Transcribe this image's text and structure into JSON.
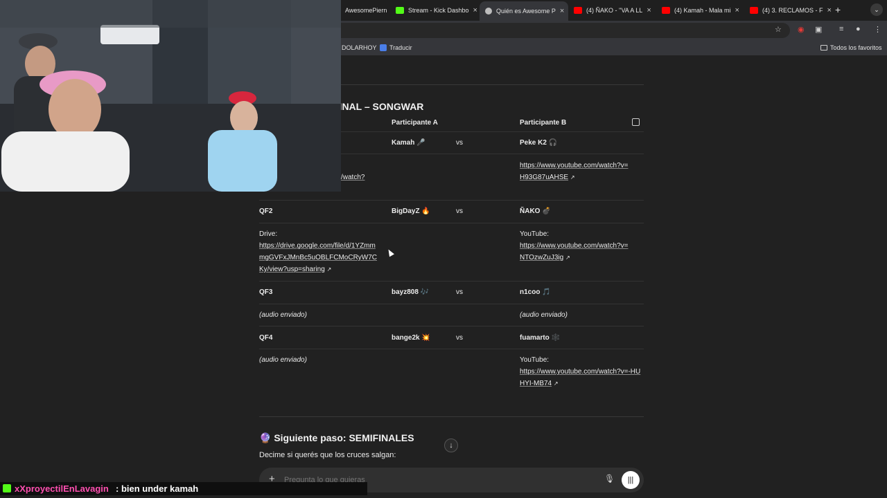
{
  "browser": {
    "tabs": [
      {
        "label": "AwesomePiern",
        "color": "#8a8a8a"
      },
      {
        "label": "Stream - Kick Dashbo",
        "color": "#53fc18"
      },
      {
        "label": "Quién es Awesome P",
        "color": "#bdbdbd",
        "active": true
      },
      {
        "label": "(4) ÑAKO - ''VA A LL",
        "color": "#ff0000"
      },
      {
        "label": "(4) Kamah - Mala mi",
        "color": "#ff0000"
      },
      {
        "label": "(4) 3. RECLAMOS - F",
        "color": "#ff0000"
      }
    ],
    "close_glyph": "×",
    "new_tab_glyph": "+",
    "bookmarks": {
      "items": [
        "DOLARHOY",
        "Traducir"
      ],
      "all_label": "Todos los favoritos"
    }
  },
  "doc": {
    "heading": "FINAL – SONGWAR",
    "columns": {
      "a": "Participante A",
      "b": "Participante B"
    },
    "vs": "vs",
    "rows": {
      "qf1": {
        "a": "Kamah 🎤",
        "b": "Peke K2 🎧",
        "a_link": "/watch?",
        "b_link": "https://www.youtube.com/watch?v=H93G87uAHSE"
      },
      "qf2": {
        "id": "QF2",
        "a": "BigDayZ 🔥",
        "b": "ÑAKO 💣",
        "a_prefix": "Drive:",
        "a_link": "https://drive.google.com/file/d/1YZmmmgGVFxJMnBc5uOBLFCMoCRyW7CKy/view?usp=sharing",
        "b_prefix": "YouTube:",
        "b_link": "https://www.youtube.com/watch?v=NTOzwZuJ3ig"
      },
      "qf3": {
        "id": "QF3",
        "a": "bayz808 🎶",
        "b": "n1coo 🎵",
        "a_note": "(audio enviado)",
        "b_note": "(audio enviado)"
      },
      "qf4": {
        "id": "QF4",
        "a": "bange2k 💥",
        "b": "fuamarto 🕸️",
        "a_note": "(audio enviado)",
        "b_prefix": "YouTube:",
        "b_link": "https://www.youtube.com/watch?v=-HUHYI-MB74"
      }
    },
    "next": {
      "title": "🔮 Siguiente paso: SEMIFINALES",
      "body": "Decime si querés que los cruces salgan:"
    },
    "ext_glyph": "↗"
  },
  "composer": {
    "placeholder": "Pregunta lo que quieras",
    "plus": "+"
  },
  "chat": {
    "user": "xXproyectilEnLavagin",
    "message": ": bien under kamah",
    "user_color": "#ff4fb0",
    "badge_color": "#53fc18"
  }
}
